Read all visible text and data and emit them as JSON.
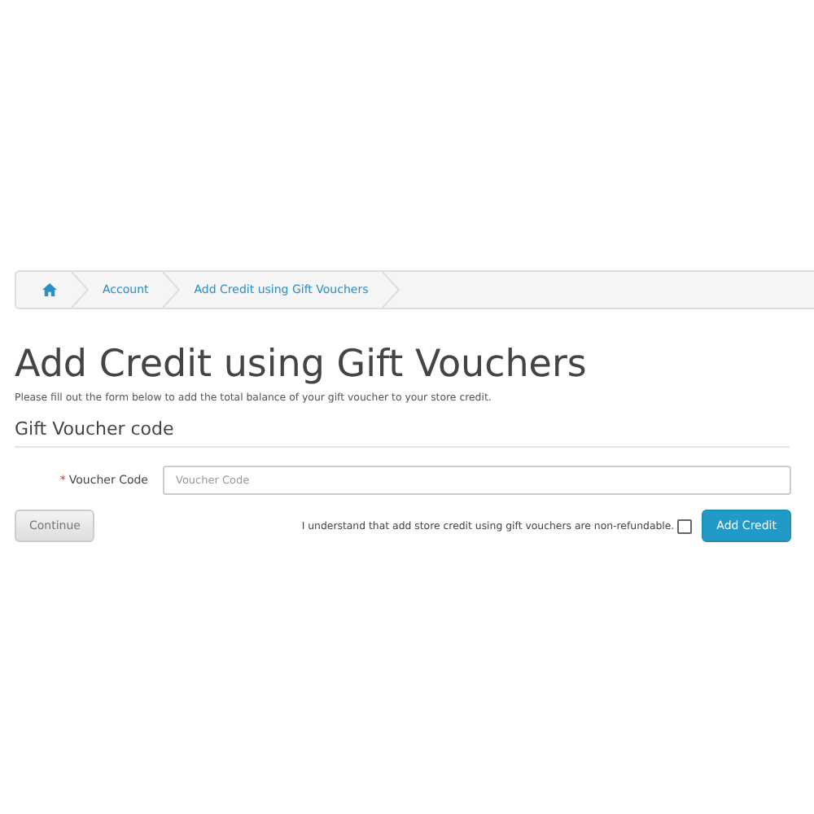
{
  "breadcrumb": [
    {
      "kind": "home"
    },
    {
      "kind": "link",
      "label": "Account"
    },
    {
      "kind": "link",
      "label": "Add Credit using Gift Vouchers"
    }
  ],
  "title": "Add Credit using Gift Vouchers",
  "description": "Please fill out the form below to add the total balance of your gift voucher to your store credit.",
  "legend": "Gift Voucher code",
  "field": {
    "required_mark": "*",
    "label": "Voucher Code",
    "placeholder": "Voucher Code"
  },
  "continue_button": "Continue",
  "agreement": {
    "text": "I understand that add store credit using gift vouchers are non-refundable.",
    "checked": false
  },
  "submit_button": "Add Credit"
}
